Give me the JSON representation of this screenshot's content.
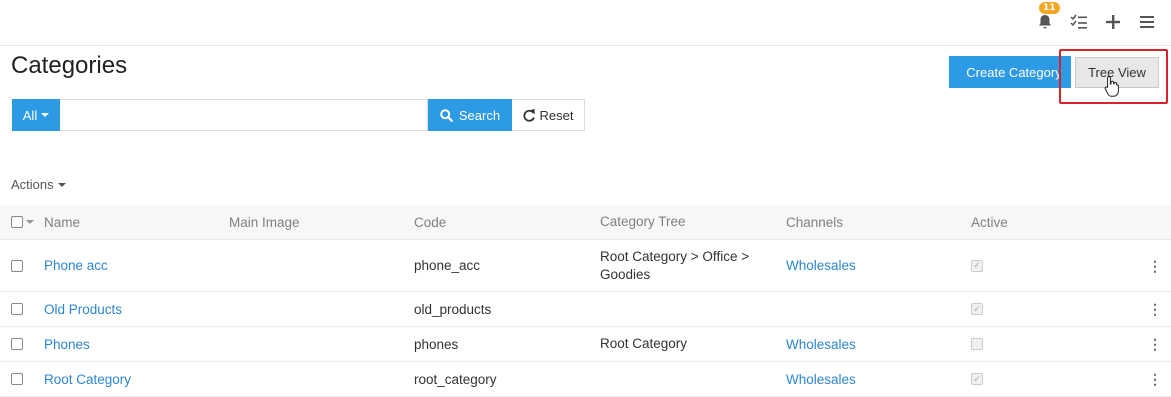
{
  "header": {
    "notification_count": "11",
    "icons": [
      "bell-icon",
      "tasks-icon",
      "plus-icon",
      "menu-icon"
    ]
  },
  "page": {
    "title": "Categories",
    "create_button": "Create Category",
    "tree_view_button": "Tree View"
  },
  "search": {
    "scope_label": "All",
    "query": "",
    "search_label": "Search",
    "reset_label": "Reset"
  },
  "actions_label": "Actions",
  "table": {
    "columns": [
      "Name",
      "Main Image",
      "Code",
      "Category Tree",
      "Channels",
      "Active"
    ],
    "rows": [
      {
        "name": "Phone acc",
        "main_image": "",
        "code": "phone_acc",
        "category_tree": "Root Category > Office > Goodies",
        "channels": "Wholesales",
        "active": true
      },
      {
        "name": "Old Products",
        "main_image": "",
        "code": "old_products",
        "category_tree": "",
        "channels": "",
        "active": true
      },
      {
        "name": "Phones",
        "main_image": "",
        "code": "phones",
        "category_tree": "Root Category",
        "channels": "Wholesales",
        "active": false
      },
      {
        "name": "Root Category",
        "main_image": "",
        "code": "root_category",
        "category_tree": "",
        "channels": "Wholesales",
        "active": true
      }
    ]
  },
  "colors": {
    "primary": "#2d9ae6",
    "link": "#2d86d0",
    "highlight": "#d4232a",
    "badge": "#f5a623"
  }
}
